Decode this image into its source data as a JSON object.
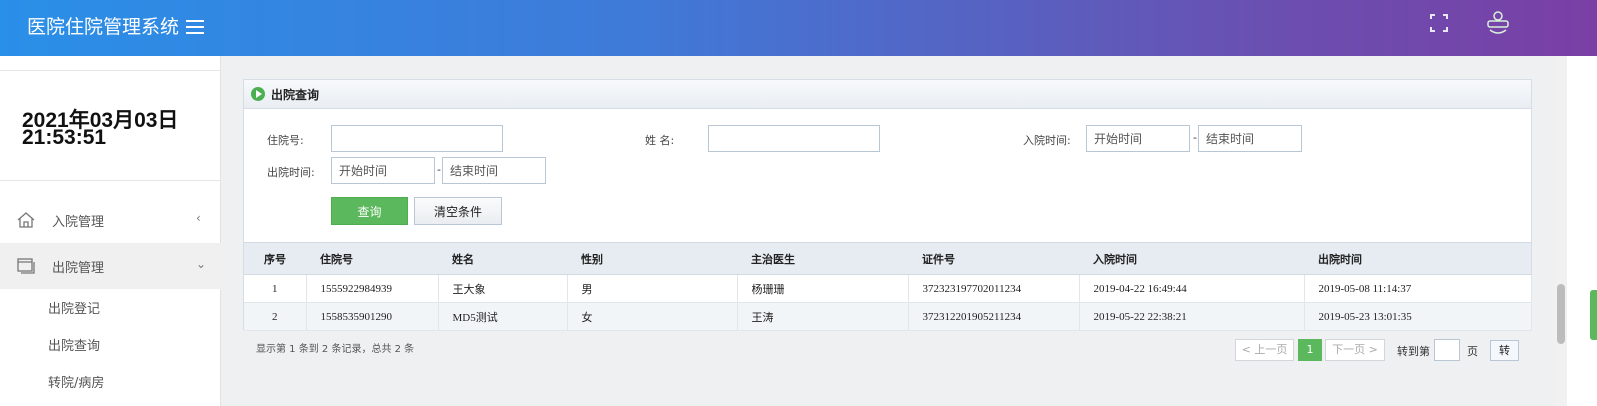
{
  "header": {
    "app_title": "医院住院管理系统",
    "menu_icon": "hamburger-icon",
    "fullscreen_icon": "fullscreen-icon",
    "avatar_icon": "user-avatar-icon"
  },
  "sidebar": {
    "date": "2021年03月03日",
    "time": "21:53:51",
    "menu": [
      {
        "label": "入院管理",
        "icon": "home-icon",
        "caret": "‹"
      },
      {
        "label": "出院管理",
        "icon": "window-icon",
        "caret": "⌄"
      }
    ],
    "submenu": [
      "出院登记",
      "出院查询",
      "转院/病房"
    ]
  },
  "panel": {
    "title": "出院查询",
    "icon": "play-circle-icon"
  },
  "form": {
    "admission_no_label": "住院号:",
    "name_label": "姓 名:",
    "admit_time_label": "入院时间:",
    "discharge_time_label": "出院时间:",
    "start_placeholder": "开始时间",
    "end_placeholder": "结束时间",
    "range_sep": "-",
    "query_button": "查询",
    "clear_button": "清空条件"
  },
  "table": {
    "columns": [
      "序号",
      "住院号",
      "姓名",
      "性别",
      "主治医生",
      "证件号",
      "入院时间",
      "出院时间"
    ],
    "rows": [
      [
        "1",
        "1555922984939",
        "王大象",
        "男",
        "杨珊珊",
        "372323197702011234",
        "2019-04-22 16:49:44",
        "2019-05-08 11:14:37"
      ],
      [
        "2",
        "1558535901290",
        "MD5测试",
        "女",
        "王涛",
        "372312201905211234",
        "2019-05-22 22:38:21",
        "2019-05-23 13:01:35"
      ]
    ]
  },
  "pagination": {
    "summary": "显示第 1 条到 2 条记录，总共 2 条",
    "prev": "< 上一页",
    "current": "1",
    "next": "下一页 >",
    "goto_label": "转到第",
    "page_unit": "页",
    "go_button": "转"
  },
  "colors": {
    "header_gradient_start": "#2a8fe8",
    "header_gradient_end": "#7a3fa6",
    "primary_green": "#5cb85c"
  }
}
